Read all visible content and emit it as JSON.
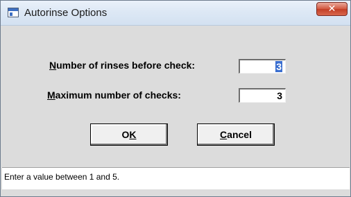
{
  "window": {
    "title": "Autorinse Options",
    "close_glyph": "✕"
  },
  "form": {
    "rinses_label_accel": "N",
    "rinses_label_rest": "umber of rinses before check:",
    "rinses_value": "3",
    "checks_label_accel": "M",
    "checks_label_rest": "aximum number of checks:",
    "checks_value": "3"
  },
  "buttons": {
    "ok_pre": "O",
    "ok_accel": "K",
    "cancel_accel": "C",
    "cancel_rest": "ancel"
  },
  "status": {
    "text": "Enter a value between 1 and 5."
  },
  "icons": {
    "app": "app-window-icon",
    "close": "close-icon"
  },
  "colors": {
    "close_red": "#c23f27",
    "selection_blue": "#3b6fd0",
    "window_bg": "#dcdcdc"
  }
}
